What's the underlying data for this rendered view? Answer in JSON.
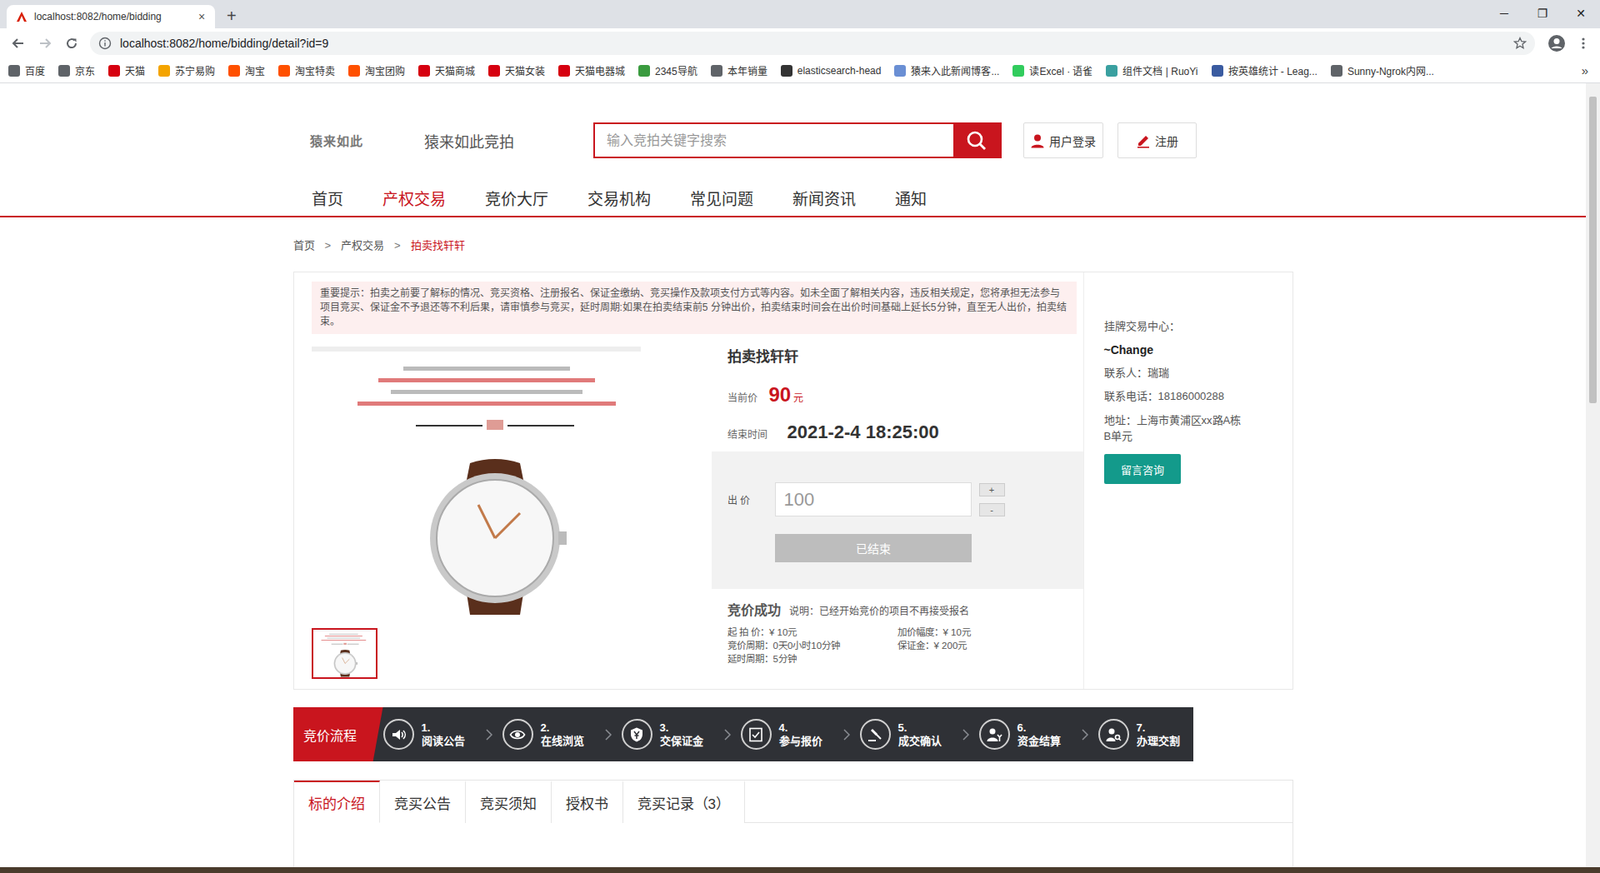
{
  "browser": {
    "tabs": [
      {
        "title": "localhost:8082/home/bidding",
        "close": "×",
        "selected": true
      }
    ],
    "new_tab": "+",
    "window_controls": [
      "─",
      "❐",
      "✕"
    ],
    "url": "localhost:8082/home/bidding/detail?id=9",
    "bookmarks": [
      {
        "label": "百度",
        "color": "#5f6368"
      },
      {
        "label": "京东",
        "color": "#5f6368"
      },
      {
        "label": "天猫",
        "color": "#d6000f"
      },
      {
        "label": "苏宁易购",
        "color": "#f4a400"
      },
      {
        "label": "淘宝",
        "color": "#ff5000"
      },
      {
        "label": "淘宝特卖",
        "color": "#ff5000"
      },
      {
        "label": "淘宝团购",
        "color": "#ff5000"
      },
      {
        "label": "天猫商城",
        "color": "#d6000f"
      },
      {
        "label": "天猫女装",
        "color": "#d6000f"
      },
      {
        "label": "天猫电器城",
        "color": "#d6000f"
      },
      {
        "label": "2345导航",
        "color": "#3a9b3f"
      },
      {
        "label": "本年销量",
        "color": "#5f6368"
      },
      {
        "label": "elasticsearch-head",
        "color": "#333333"
      },
      {
        "label": "猿来入此新闻博客...",
        "color": "#6a8fd4"
      },
      {
        "label": "读Excel · 语雀",
        "color": "#31cc5d"
      },
      {
        "label": "组件文档 | RuoYi",
        "color": "#3aa0a0"
      },
      {
        "label": "按英雄统计 - Leag...",
        "color": "#3a5ba0"
      },
      {
        "label": "Sunny-Ngrok内网...",
        "color": "#5f6368"
      }
    ],
    "bookmarks_more": "»"
  },
  "header": {
    "logo": "猿来如此",
    "site_name": "猿来如此竞拍",
    "search": {
      "placeholder": "输入竞拍关键字搜索"
    },
    "login": "用户登录",
    "register": "注册"
  },
  "nav": [
    {
      "label": "首页",
      "selected": false
    },
    {
      "label": "产权交易",
      "selected": true
    },
    {
      "label": "竞价大厅",
      "selected": false
    },
    {
      "label": "交易机构",
      "selected": false
    },
    {
      "label": "常见问题",
      "selected": false
    },
    {
      "label": "新闻资讯",
      "selected": false
    },
    {
      "label": "通知",
      "selected": false
    }
  ],
  "breadcrumb": {
    "separator": ">",
    "items": [
      {
        "label": "首页",
        "current": false
      },
      {
        "label": "产权交易",
        "current": false
      },
      {
        "label": "拍卖找轩轩",
        "current": true
      }
    ]
  },
  "notice": "重要提示：拍卖之前要了解标的情况、竞买资格、注册报名、保证金缴纳、竞买操作及款项支付方式等内容。如未全面了解相关内容，违反相关规定，您将承担无法参与项目竞买、保证金不予退还等不利后果，请审慎参与竞买，延时周期:如果在拍卖结束前5 分钟出价，拍卖结束时间会在出价时间基础上延长5分钟，直至无人出价，拍卖结束。",
  "gallery": {
    "thumbnails": [
      {
        "selected": true
      }
    ]
  },
  "item": {
    "title": "拍卖找轩轩",
    "price_label": "当前价",
    "price": "90",
    "price_unit": "元",
    "end_label": "结束时间",
    "end_time": "2021-2-4 18:25:00"
  },
  "bid": {
    "label": "出 价",
    "value": "100",
    "plus": "+",
    "minus": "-",
    "button": "已结束",
    "disabled": true
  },
  "result": {
    "status": "竞价成功",
    "note": "说明：已经开始竞价的项目不再接受报名"
  },
  "terms": [
    "起 拍 价：¥ 10元",
    "加价幅度：¥ 10元",
    "竞价周期：0天0小时10分钟",
    "保证金：¥ 200元",
    "延时周期：5分钟"
  ],
  "agency": {
    "label": "挂牌交易中心：",
    "name": "~Change",
    "contact": "联系人：瑞瑞",
    "phone": "联系电话：18186000288",
    "address": "地址：上海市黄浦区xx路A栋B单元",
    "button": "留言咨询"
  },
  "process": {
    "title": "竞价流程",
    "steps": [
      {
        "number": "1.",
        "label": "阅读公告"
      },
      {
        "number": "2.",
        "label": "在线浏览"
      },
      {
        "number": "3.",
        "label": "交保证金"
      },
      {
        "number": "4.",
        "label": "参与报价"
      },
      {
        "number": "5.",
        "label": "成交确认"
      },
      {
        "number": "6.",
        "label": "资金结算"
      },
      {
        "number": "7.",
        "label": "办理交割"
      }
    ]
  },
  "detail_tabs": [
    {
      "label": "标的介绍",
      "selected": true
    },
    {
      "label": "竞买公告",
      "selected": false
    },
    {
      "label": "竞买须知",
      "selected": false
    },
    {
      "label": "授权书",
      "selected": false
    },
    {
      "label": "竞买记录（3）",
      "selected": false
    }
  ]
}
